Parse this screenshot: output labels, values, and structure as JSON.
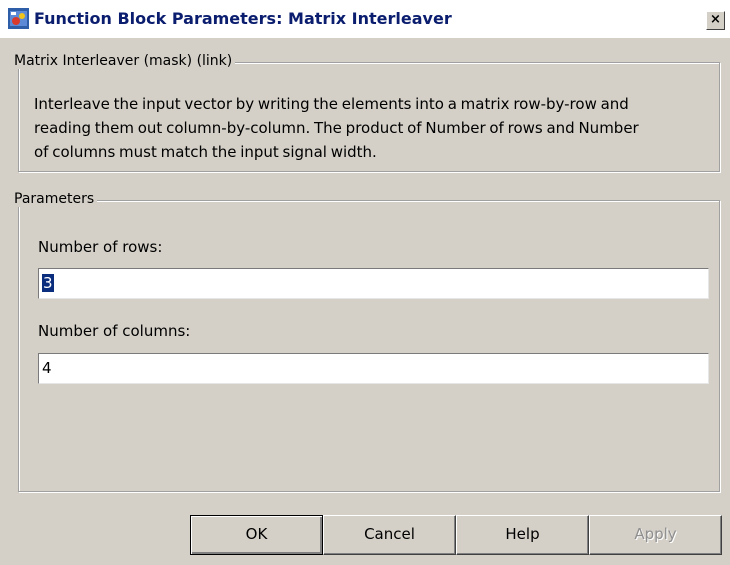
{
  "window": {
    "title": "Function Block Parameters: Matrix Interleaver",
    "close_label": "×",
    "icon": "simulink-block-icon"
  },
  "description": {
    "group_label": "Matrix Interleaver (mask) (link)",
    "lines": [
      "Interleave the input vector by writing the elements into a matrix row-by-row and",
      "reading them out column-by-column.  The product of Number of rows and Number",
      "of columns must match the input signal width."
    ]
  },
  "parameters": {
    "group_label": "Parameters",
    "rows": {
      "label": "Number of rows:",
      "value": "3",
      "selected": true
    },
    "columns": {
      "label": "Number of columns:",
      "value": "4"
    }
  },
  "buttons": {
    "ok": "OK",
    "cancel": "Cancel",
    "help": "Help",
    "apply": "Apply"
  },
  "colors": {
    "dialog_background": "#d4d0c8",
    "title_text": "#0a1d6e",
    "selection": "#0b2d7e",
    "disabled_text": "#8f8f8f"
  }
}
